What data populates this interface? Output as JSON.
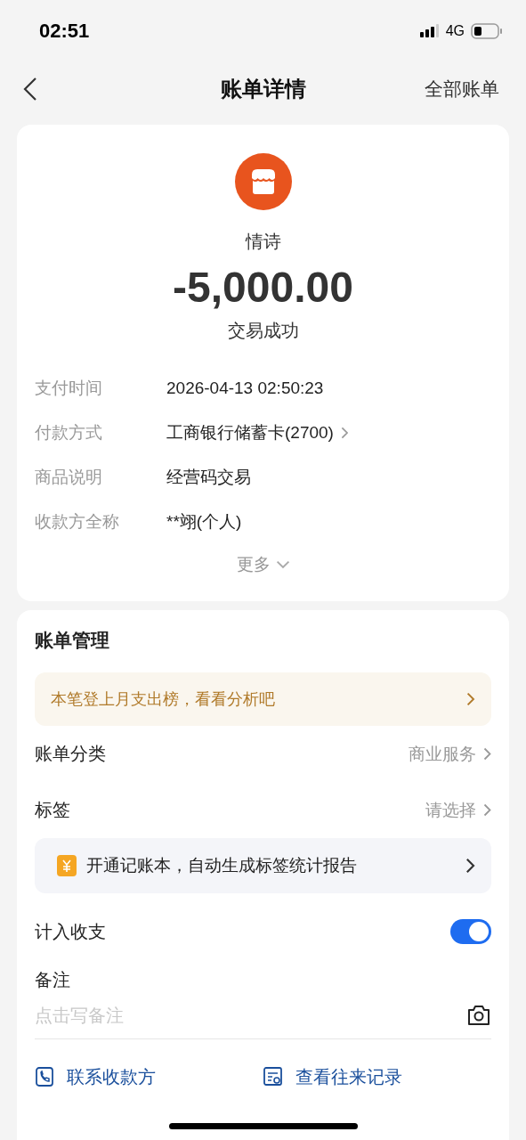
{
  "status_bar": {
    "time": "02:51",
    "network": "4G"
  },
  "nav": {
    "title": "账单详情",
    "action": "全部账单"
  },
  "summary": {
    "merchant": "情诗",
    "amount": "-5,000.00",
    "status": "交易成功"
  },
  "details": [
    {
      "label": "支付时间",
      "value": "2026-04-13 02:50:23",
      "kind": "plain"
    },
    {
      "label": "付款方式",
      "value": "工商银行储蓄卡(2700)",
      "kind": "link"
    },
    {
      "label": "商品说明",
      "value": "经营码交易",
      "kind": "plain"
    },
    {
      "label": "收款方全称",
      "value": "**翊(个人)",
      "kind": "plain"
    }
  ],
  "more": "更多",
  "management": {
    "title": "账单管理",
    "banner": "本笔登上月支出榜，看看分析吧",
    "settings": [
      {
        "label": "账单分类",
        "value": "商业服务"
      },
      {
        "label": "标签",
        "value": "请选择"
      }
    ],
    "promo": "开通记账本，自动生成标签统计报告",
    "toggle": {
      "label": "计入收支",
      "on": true
    },
    "note": {
      "label": "备注",
      "placeholder": "点击写备注"
    },
    "actions": [
      {
        "label": "联系收款方",
        "kind": "contact"
      },
      {
        "label": "查看往来记录",
        "kind": "records"
      }
    ]
  }
}
